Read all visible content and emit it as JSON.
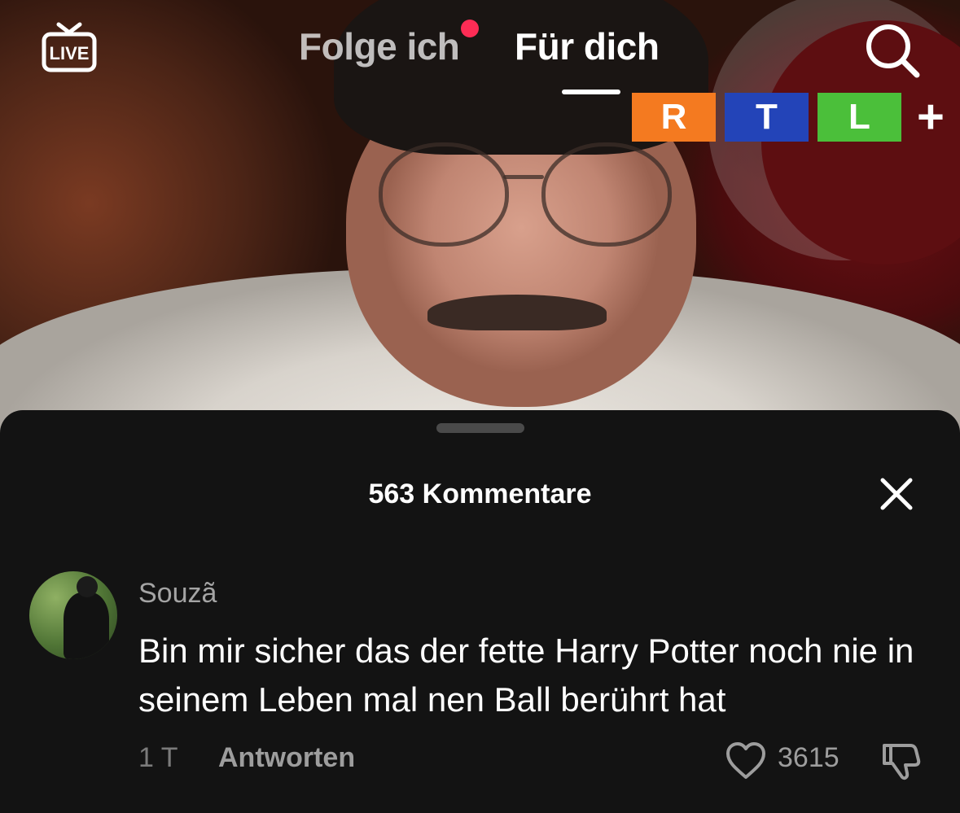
{
  "header": {
    "live_icon": "live-tv-icon",
    "live_label": "LIVE",
    "tabs": [
      {
        "label": "Folge ich",
        "active": false,
        "has_notification_dot": true
      },
      {
        "label": "Für dich",
        "active": true
      }
    ],
    "search_icon": "search-icon"
  },
  "broadcaster_logo": {
    "letters": [
      "R",
      "T",
      "L"
    ],
    "suffix": "+",
    "colors": [
      "#f47a20",
      "#2344b8",
      "#4bbf3a"
    ]
  },
  "comments_sheet": {
    "title": "563 Kommentare",
    "close_icon": "close-icon",
    "comments": [
      {
        "username": "Souzã",
        "text": "Bin mir sicher das der fette Harry Potter noch nie in seinem Leben mal nen Ball berührt hat",
        "time": "1 T",
        "reply_label": "Antworten",
        "likes": "3615",
        "like_icon": "heart-icon",
        "dislike_icon": "thumbs-down-icon"
      }
    ]
  },
  "colors": {
    "accent": "#fe2c55",
    "sheet_background": "#131313",
    "secondary_text": "#a4a4a4"
  }
}
